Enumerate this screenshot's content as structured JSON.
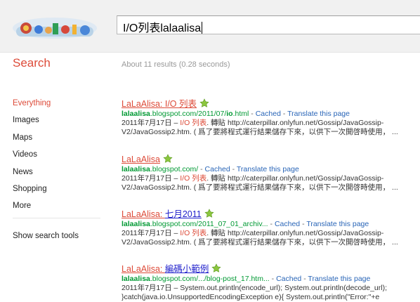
{
  "query": "I/O列表lalaalisa",
  "sidebar_title": "Search",
  "stats": "About 11 results (0.28 seconds)",
  "nav": [
    "Everything",
    "Images",
    "Maps",
    "Videos",
    "News",
    "Shopping",
    "More"
  ],
  "tools": "Show search tools",
  "results": [
    {
      "title_a": "LaLaAlisa: ",
      "title_b": "I/O 列表",
      "url_bold": "lalaalisa",
      "url_mid": ".blogspot.com/2011/07/",
      "url_bold2": "io",
      "url_end": ".html",
      "cached": "Cached",
      "translate": "Translate this page",
      "snip1_a": "2011年7月17日 – ",
      "snip1_red": "I/O 列表",
      "snip1_b": ". 轉貼 http://caterpillar.onlyfun.net/Gossip/JavaGossip-",
      "snip2": "V2/JavaGossip2.htm. ( 爲了要將程式運行結果儲存下來，以供下一次開啓時使用， ..."
    },
    {
      "title_a": "LaLaAlisa",
      "title_b": "",
      "url_bold": "lalaalisa",
      "url_mid": ".blogspot.com/",
      "url_bold2": "",
      "url_end": "",
      "cached": "Cached",
      "translate": "Translate this page",
      "snip1_a": "2011年7月17日 – ",
      "snip1_red": "I/O 列表",
      "snip1_b": ". 轉貼 http://caterpillar.onlyfun.net/Gossip/JavaGossip-",
      "snip2": "V2/JavaGossip2.htm. ( 爲了要將程式運行結果儲存下來，以供下一次開啓時使用， ..."
    },
    {
      "title_a": "LaLaAlisa: ",
      "title_b": "七月2011",
      "url_bold": "lalaalisa",
      "url_mid": ".blogspot.com/2011_07_01_archiv...",
      "url_bold2": "",
      "url_end": "",
      "cached": "Cached",
      "translate": "Translate this page",
      "snip1_a": "2011年7月17日 – ",
      "snip1_red": "I/O 列表",
      "snip1_b": ". 轉貼 http://caterpillar.onlyfun.net/Gossip/JavaGossip-",
      "snip2": "V2/JavaGossip2.htm. ( 爲了要將程式運行結果儲存下來，以供下一次開啓時使用， ..."
    },
    {
      "title_a": "LaLaAlisa: ",
      "title_b": "編碼小範例",
      "url_bold": "lalaalisa",
      "url_mid": ".blogspot.com/.../blog-post_17.htm...",
      "url_bold2": "",
      "url_end": "",
      "cached": "Cached",
      "translate": "Translate this page",
      "snip1_a": "2011年7月17日 – System.out.println(encode_url); System.out.println(decode_url);",
      "snip1_red": "",
      "snip1_b": "",
      "snip2": "}catch(java.io.UnsupportedEncodingException e){ System.out.println(\"Error:\"+e"
    }
  ]
}
